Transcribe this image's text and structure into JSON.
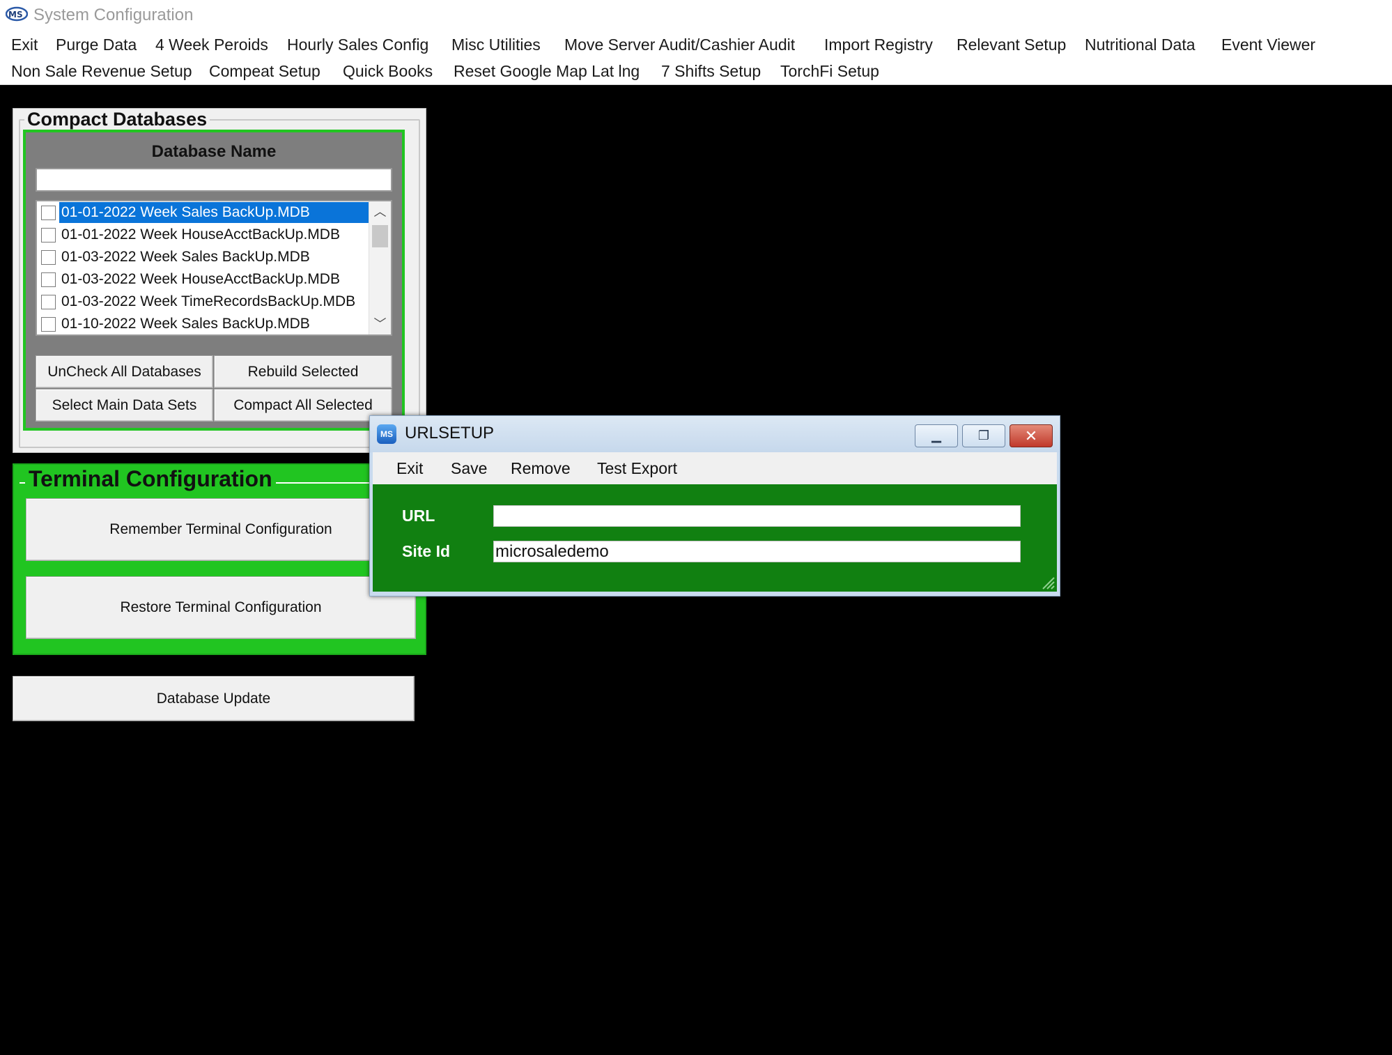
{
  "window": {
    "title": "System Configuration",
    "app_icon": "microsale-logo"
  },
  "menu": {
    "row1": [
      "Exit",
      "Purge Data",
      "4 Week Peroids",
      "Hourly Sales Config",
      "Misc Utilities",
      "Move Server Audit/Cashier Audit",
      "Import Registry",
      "Relevant Setup",
      "Nutritional Data",
      "Event Viewer"
    ],
    "row2": [
      "Non Sale Revenue Setup",
      "Compeat Setup",
      "Quick Books",
      "Reset Google Map Lat lng",
      "7 Shifts Setup",
      "TorchFi Setup"
    ]
  },
  "compact": {
    "title": "Compact Databases",
    "db_name_label": "Database Name",
    "db_name_value": "",
    "items": [
      {
        "label": "01-01-2022 Week  Sales BackUp.MDB",
        "checked": false,
        "selected": true
      },
      {
        "label": "01-01-2022 Week HouseAcctBackUp.MDB",
        "checked": false,
        "selected": false
      },
      {
        "label": "01-03-2022 Week  Sales BackUp.MDB",
        "checked": false,
        "selected": false
      },
      {
        "label": "01-03-2022 Week HouseAcctBackUp.MDB",
        "checked": false,
        "selected": false
      },
      {
        "label": "01-03-2022 Week TimeRecordsBackUp.MDB",
        "checked": false,
        "selected": false
      },
      {
        "label": "01-10-2022 Week  Sales BackUp.MDB",
        "checked": false,
        "selected": false
      }
    ],
    "buttons": {
      "uncheck_all": "UnCheck All Databases",
      "rebuild_selected": "Rebuild Selected",
      "select_main": "Select Main Data Sets",
      "compact_all": "Compact All Selected"
    }
  },
  "terminal": {
    "title": "Terminal Configuration",
    "remember": "Remember Terminal Configuration",
    "restore": "Restore Terminal Configuration"
  },
  "database_update": "Database Update",
  "dialog": {
    "title": "URLSETUP",
    "menu": [
      "Exit",
      "Save",
      "Remove",
      "Test Export"
    ],
    "url_label": "URL",
    "url_value": "",
    "siteid_label": "Site Id",
    "siteid_value": "microsaledemo"
  },
  "colors": {
    "background": "#000000",
    "terminal_green": "#21c521",
    "dialog_green": "#118011",
    "selection_blue": "#0a74d9"
  }
}
